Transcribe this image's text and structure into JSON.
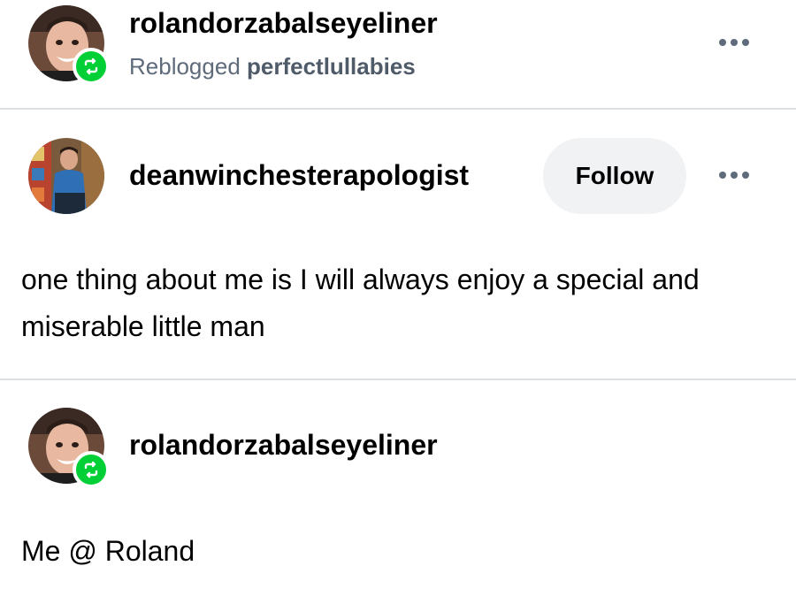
{
  "header": {
    "username": "rolandorzabalseyeliner",
    "reblogged_prefix": "Reblogged",
    "reblogged_from": "perfectlullabies",
    "menu_icon": "more-horizontal-icon"
  },
  "original_post": {
    "username": "deanwinchesterapologist",
    "follow_label": "Follow",
    "text": "one thing about me is I will always enjoy a special and miserable little man"
  },
  "reply_post": {
    "username": "rolandorzabalseyeliner",
    "text": "Me @ Roland"
  },
  "colors": {
    "reblog_green": "#00cf35",
    "muted_text": "#5f6b7a",
    "follow_bg": "#f1f2f4",
    "divider": "#dcdfe3"
  }
}
